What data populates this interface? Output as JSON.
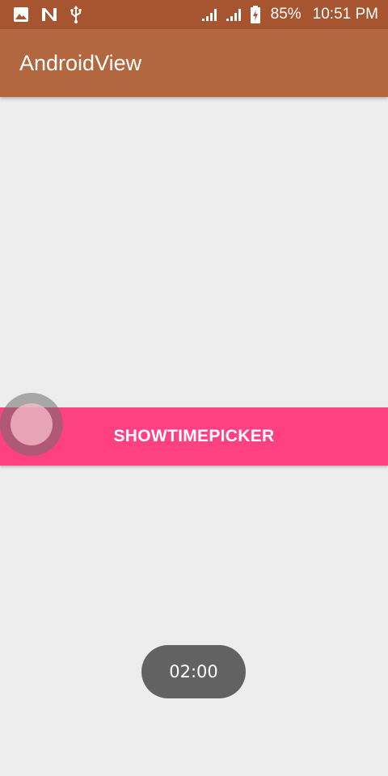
{
  "status_bar": {
    "left_icons": [
      "image-notification-icon",
      "n-notification-icon",
      "usb-icon"
    ],
    "right_icons": [
      "signal-icon",
      "signal-icon",
      "battery-charging-icon"
    ],
    "battery_percent": "85%",
    "time": "10:51 PM"
  },
  "app_bar": {
    "title": "AndroidView"
  },
  "main": {
    "button_label": "SHOWTIMEPICKER"
  },
  "toast": {
    "text": "02:00"
  },
  "colors": {
    "status_bar": "#a65530",
    "app_bar": "#b3673f",
    "accent": "#ff4081",
    "background": "#ededed",
    "toast": "#626262"
  }
}
